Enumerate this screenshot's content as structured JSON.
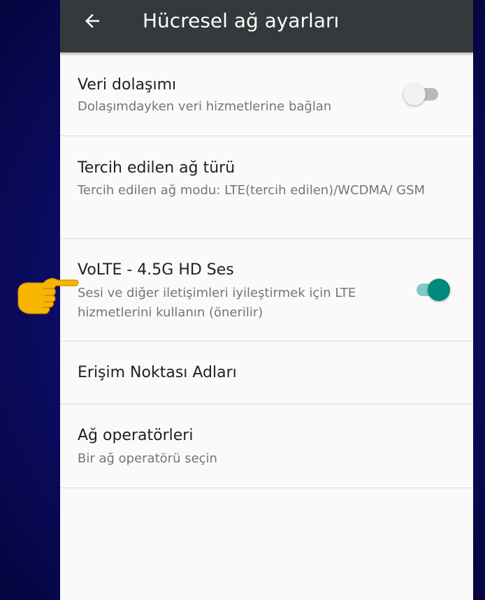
{
  "app_bar": {
    "back_icon": "arrow-back-icon",
    "title": "Hücresel ağ ayarları",
    "background": "#34393b"
  },
  "settings": [
    {
      "title": "Veri dolaşımı",
      "summary": "Dolaşımdayken veri hizmetlerine bağlan",
      "switch_state": "off"
    },
    {
      "title": "Tercih edilen ağ türü",
      "summary": "Tercih edilen ağ modu: LTE(tercih edilen)/WCDMA/ GSM"
    },
    {
      "title": "VoLTE - 4.5G HD Ses",
      "summary": "Sesi ve diğer iletişimleri iyileştirmek için LTE hizmetlerini kullanın (önerilir)",
      "switch_state": "on"
    },
    {
      "title": "Erişim Noktası Adları"
    },
    {
      "title": "Ağ operatörleri",
      "summary": "Bir ağ operatörü seçin"
    }
  ],
  "colors": {
    "accent": "#00897b",
    "accent_track": "#80cbc4",
    "background": "#fafafa",
    "outer_background": "#0d0d6b",
    "pointer": "#f7b500"
  },
  "annotation": {
    "pointer_icon": "pointing-hand-icon"
  }
}
